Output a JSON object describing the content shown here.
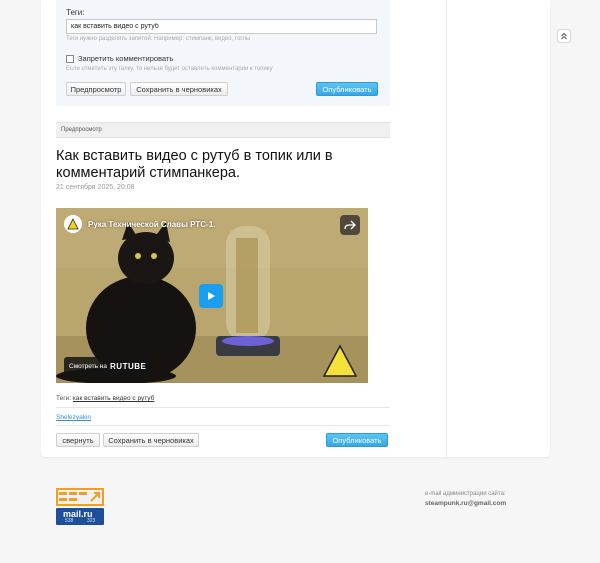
{
  "form": {
    "tags_label": "Теги:",
    "tags_value": "как вставить видео с рутуб",
    "tags_hint": "Теги нужно разделять запятой. Например: стимпанк, видео, гоглы",
    "no_comments_label": "Запретить комментировать",
    "no_comments_hint": "Если отметить эту галку, то нельзя будет оставлять комментарии к топику",
    "preview_button": "Предпросмотр",
    "save_drafts_button": "Сохранить в черновиках",
    "publish_button": "Опубликовать"
  },
  "preview": {
    "header": "Предпросмотр",
    "post_title": "Как вставить видео с рутуб в топик или в комментарий стимпанкера.",
    "post_date": "21 сентября 2025, 20:08",
    "video": {
      "title": "Рука Технической Славы РТС-1.",
      "watch_on": "Смотреть на",
      "brand": "RUTUBE"
    },
    "tags_prefix": "Теги:",
    "tag_link": "как вставить видео с рутуб",
    "author": "Shelezyakin",
    "collapse_button": "свернуть",
    "save_drafts_button": "Сохранить в черновиках",
    "publish_button": "Опубликовать"
  },
  "footer": {
    "mailru_brand": "mail.ru",
    "counter_1": "538",
    "counter_2": "323",
    "admin_label": "e-mail администрации сайта:",
    "admin_email": "steampunk.ru@gmail.com"
  },
  "colors": {
    "accent": "#35a8e6",
    "link": "#3a8fd0",
    "mailru_bg": "#1d4f9b"
  },
  "icons": {
    "scroll_top": "double-chevron-up-icon",
    "share": "share-arrow-icon",
    "play": "play-icon",
    "video_logo": "warning-sign-icon"
  }
}
